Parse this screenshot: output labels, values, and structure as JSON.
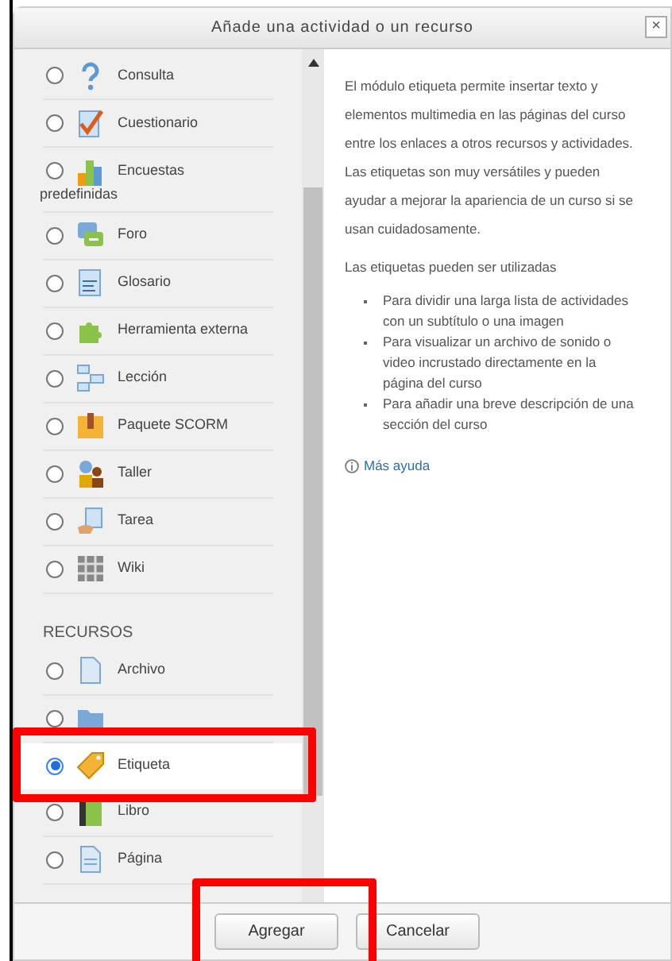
{
  "window": {
    "title": "Añade una actividad o un recurso",
    "close": "×"
  },
  "activities": [
    {
      "label": "Consulta",
      "selected": false
    },
    {
      "label": "Cuestionario",
      "selected": false
    },
    {
      "label": "Encuestas predefinidas",
      "selected": false
    },
    {
      "label": "Foro",
      "selected": false
    },
    {
      "label": "Glosario",
      "selected": false
    },
    {
      "label": "Herramienta externa",
      "selected": false
    },
    {
      "label": "Lección",
      "selected": false
    },
    {
      "label": "Paquete SCORM",
      "selected": false
    },
    {
      "label": "Taller",
      "selected": false
    },
    {
      "label": "Tarea",
      "selected": false
    },
    {
      "label": "Wiki",
      "selected": false
    }
  ],
  "resources_heading": "RECURSOS",
  "resources": [
    {
      "label": "Archivo",
      "selected": false
    },
    {
      "selected": false
    },
    {
      "label": "Etiqueta",
      "selected": true
    },
    {
      "label": "Libro",
      "selected": false
    },
    {
      "label": "Página",
      "selected": false
    }
  ],
  "description": {
    "paragraphs": [
      "El módulo etiqueta permite insertar texto y elementos multimedia en las páginas del curso entre los enlaces a otros recursos y actividades. Las etiquetas son muy versátiles y pueden ayudar a mejorar la apariencia de un curso si se usan cuidadosamente.",
      "Las etiquetas pueden ser utilizadas"
    ],
    "bullets": [
      "Para dividir una larga lista de actividades con un subtítulo o una imagen",
      "Para visualizar un archivo de sonido o video incrustado directamente en la página del curso",
      "Para añadir una breve descripción de una sección del curso"
    ],
    "help_link": "Más ayuda"
  },
  "buttons": [
    "Agregar",
    "Cancelar"
  ]
}
